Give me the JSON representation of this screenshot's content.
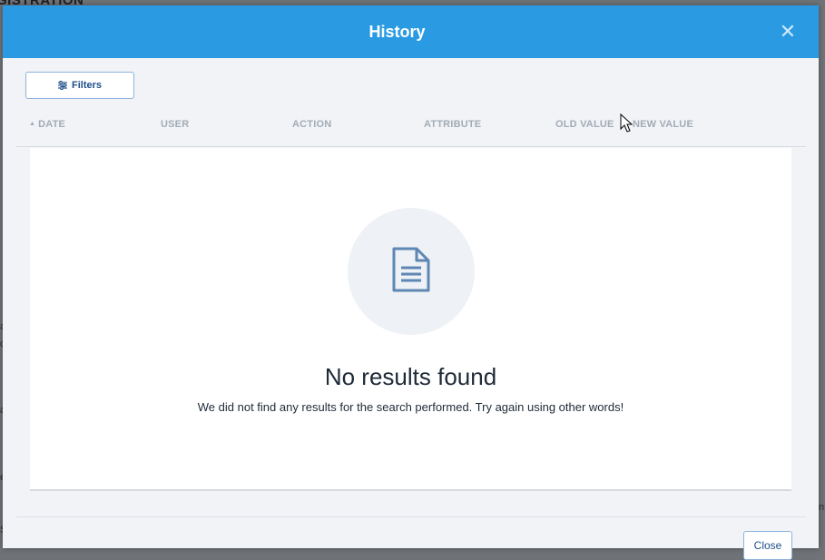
{
  "background": {
    "title_fragment": "GISTRATION",
    "side_fragments": [
      "a",
      "c",
      "a",
      "e",
      "S"
    ],
    "right_fragment": "n"
  },
  "modal": {
    "title": "History",
    "close_icon": "close-icon",
    "filters_label": "Filters",
    "filters_icon": "sliders-icon",
    "columns": [
      "DATE",
      "USER",
      "ACTION",
      "ATTRIBUTE",
      "OLD VALUE",
      "NEW VALUE"
    ],
    "sort": {
      "column": "DATE",
      "direction": "ascending"
    },
    "empty_state": {
      "icon": "document-icon",
      "title": "No results found",
      "message": "We did not find any results for the search performed. Try again using other words!"
    },
    "close_button_label": "Close"
  },
  "colors": {
    "header": "#2a9be3",
    "accent_text": "#1f4e8c",
    "modal_bg": "#f1f3f6"
  }
}
